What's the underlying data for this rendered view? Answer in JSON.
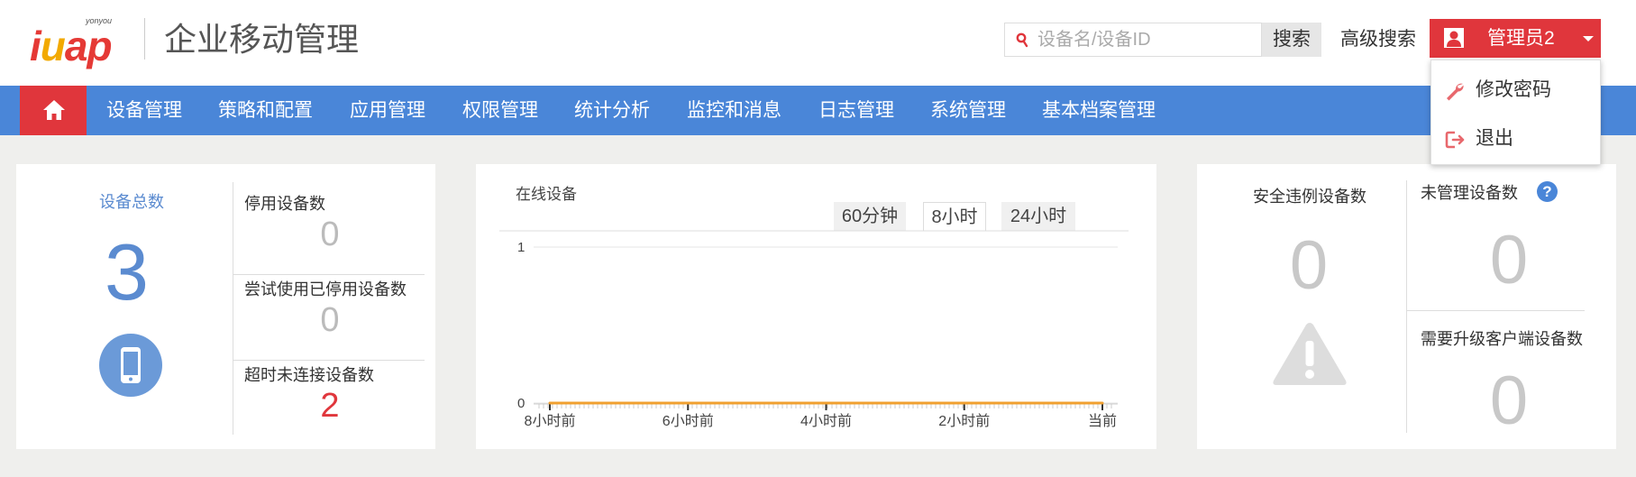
{
  "header": {
    "logo_small": "yonyou",
    "logo_text": {
      "i": "i",
      "u": "u",
      "a": "a",
      "p": "p"
    },
    "app_title": "企业移动管理",
    "search_placeholder": "设备名/设备ID",
    "search_button": "搜索",
    "advanced_search": "高级搜索",
    "user_name": "管理员2",
    "accent_color": "#e0363c"
  },
  "nav": {
    "items": [
      "设备管理",
      "策略和配置",
      "应用管理",
      "权限管理",
      "统计分析",
      "监控和消息",
      "日志管理",
      "系统管理",
      "基本档案管理"
    ],
    "bar_color": "#4a86d8"
  },
  "user_menu": {
    "items": [
      {
        "label": "修改密码",
        "icon": "wrench-icon"
      },
      {
        "label": "退出",
        "icon": "logout-icon"
      }
    ]
  },
  "device_summary": {
    "total_label": "设备总数",
    "total_value": "3",
    "stats": [
      {
        "label": "停用设备数",
        "value": "0"
      },
      {
        "label": "尝试使用已停用设备数",
        "value": "0"
      },
      {
        "label": "超时未连接设备数",
        "value": "2"
      }
    ]
  },
  "online_chart": {
    "title": "在线设备",
    "ranges": [
      "60分钟",
      "8小时",
      "24小时"
    ],
    "active_range": "8小时"
  },
  "chart_data": {
    "type": "line",
    "title": "在线设备",
    "x": [
      "8小时前",
      "6小时前",
      "4小时前",
      "2小时前",
      "当前"
    ],
    "series": [
      {
        "values": [
          0,
          0,
          0,
          0,
          0
        ]
      }
    ],
    "y_ticks": [
      "1",
      "0"
    ],
    "ylim": [
      0,
      1
    ],
    "grid": true,
    "color": "#f0a030"
  },
  "security": {
    "violation_label": "安全违例设备数",
    "violation_value": "0",
    "unmanaged_label": "未管理设备数",
    "unmanaged_value": "0",
    "help_glyph": "?",
    "upgrade_label": "需要升级客户端设备数",
    "upgrade_value": "0"
  }
}
